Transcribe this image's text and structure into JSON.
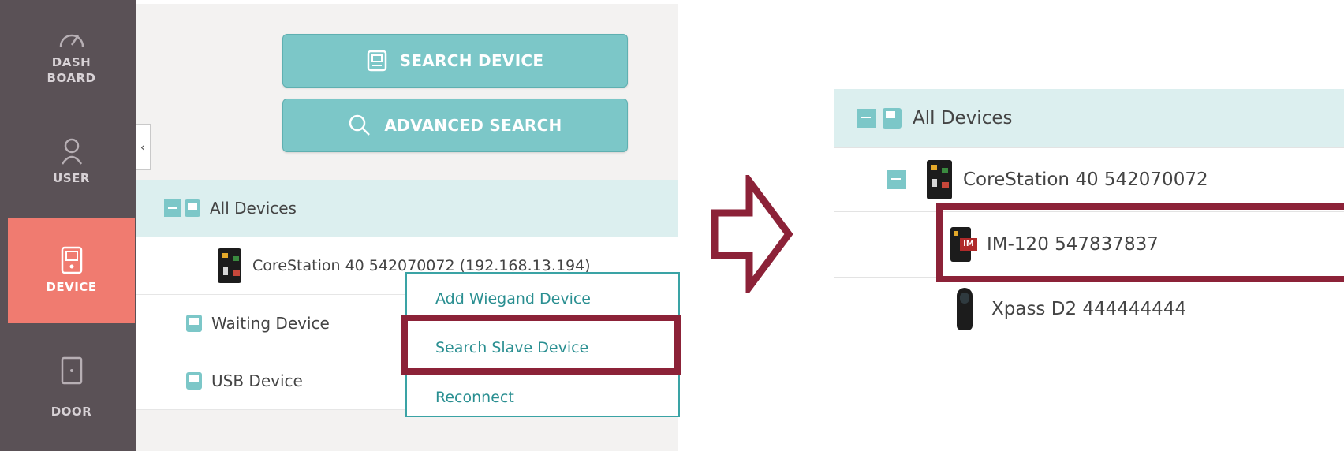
{
  "sidebar": {
    "items": [
      {
        "label_line1": "DASH",
        "label_line2": "BOARD",
        "icon": "speedometer-icon"
      },
      {
        "label": "USER",
        "icon": "user-icon"
      },
      {
        "label": "DEVICE",
        "icon": "device-icon",
        "active": true
      },
      {
        "label": "DOOR",
        "icon": "door-icon"
      }
    ]
  },
  "toolbar": {
    "search_device_label": "SEARCH DEVICE",
    "advanced_search_label": "ADVANCED SEARCH"
  },
  "tree": {
    "all_devices": "All Devices",
    "corestation": "CoreStation 40 542070072 (192.168.13.194)",
    "waiting": "Waiting Device",
    "usb": "USB Device"
  },
  "context_menu": {
    "items": [
      "Add Wiegand Device",
      "Search Slave Device",
      "Reconnect"
    ],
    "highlighted": "Search Slave Device"
  },
  "result_tree": {
    "all_devices": "All Devices",
    "corestation": "CoreStation 40 542070072",
    "slave": "IM-120 547837837",
    "slave_badge": "IM",
    "xpass": "Xpass D2 444444444"
  },
  "colors": {
    "accent": "#7cc7c8",
    "highlight": "#8c2238",
    "active_nav": "#f07b70",
    "sidebar": "#5a5156"
  }
}
